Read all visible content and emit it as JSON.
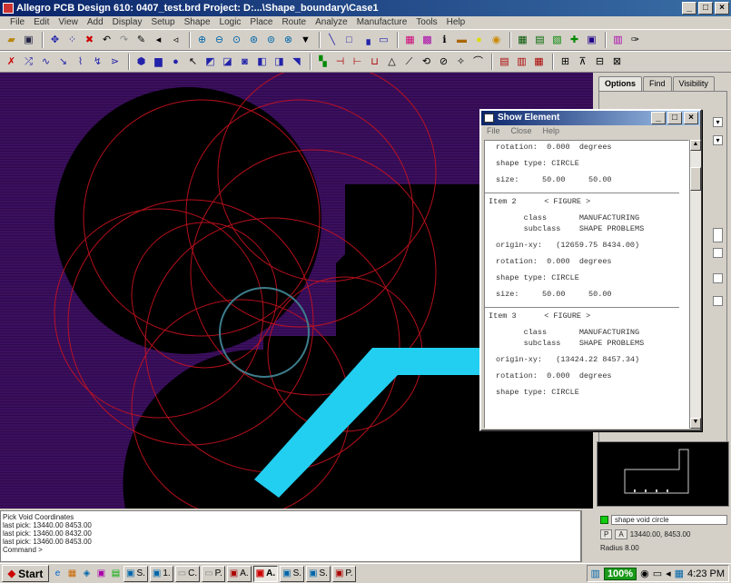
{
  "window": {
    "title": "Allegro PCB Design 610: 0407_test.brd  Project: D:...\\Shape_boundary\\Case1",
    "min": "_",
    "max": "□",
    "close": "×"
  },
  "menu": [
    "File",
    "Edit",
    "View",
    "Add",
    "Display",
    "Setup",
    "Shape",
    "Logic",
    "Place",
    "Route",
    "Analyze",
    "Manufacture",
    "Tools",
    "Help"
  ],
  "panel": {
    "tabs": [
      "Options",
      "Find",
      "Visibility"
    ]
  },
  "dialog": {
    "title": "Show Element",
    "menu": [
      "File",
      "Close",
      "Help"
    ],
    "lines": [
      {
        "t": "rotation:  0.000  degrees"
      },
      {
        "t": ""
      },
      {
        "t": "shape type: CIRCLE"
      },
      {
        "t": ""
      },
      {
        "t": "size:     50.00     50.00"
      },
      {
        "t": "",
        "hr": true
      },
      {
        "t": "Item 2      < FIGURE >",
        "item": true
      },
      {
        "t": ""
      },
      {
        "t": "      class       MANUFACTURING"
      },
      {
        "t": "      subclass    SHAPE PROBLEMS"
      },
      {
        "t": ""
      },
      {
        "t": "origin-xy:   (12659.75 8434.00)"
      },
      {
        "t": ""
      },
      {
        "t": "rotation:  0.000  degrees"
      },
      {
        "t": ""
      },
      {
        "t": "shape type: CIRCLE"
      },
      {
        "t": ""
      },
      {
        "t": "size:     50.00     50.00"
      },
      {
        "t": "",
        "hr": true
      },
      {
        "t": "Item 3      < FIGURE >",
        "item": true
      },
      {
        "t": ""
      },
      {
        "t": "      class       MANUFACTURING"
      },
      {
        "t": "      subclass    SHAPE PROBLEMS"
      },
      {
        "t": ""
      },
      {
        "t": "origin-xy:   (13424.22 8457.34)"
      },
      {
        "t": ""
      },
      {
        "t": "rotation:  0.000  degrees"
      },
      {
        "t": ""
      },
      {
        "t": "shape type: CIRCLE"
      }
    ]
  },
  "console": [
    "Pick Void Coordinates",
    "last pick:  13440.00  8453.00",
    "last pick:  13460.00  8432.00",
    "last pick:  13460.00  8453.00",
    "Command >"
  ],
  "status": {
    "mode": "shape void circle",
    "coords": "13440.00, 8453.00",
    "radius": "Radius 8.00",
    "p_label": "P",
    "a_label": "A"
  },
  "taskbar": {
    "start": "Start",
    "tasks": [
      "S.",
      "1.",
      "C.",
      "P.",
      "A.",
      "A.",
      "S.",
      "S.",
      "P."
    ],
    "zoom": "100%",
    "time": "4:23 PM"
  },
  "colors": {
    "canvas": "#3b0f5e",
    "shape": "#000000",
    "etch": "#2ad4f0",
    "drc": "#d01818"
  }
}
